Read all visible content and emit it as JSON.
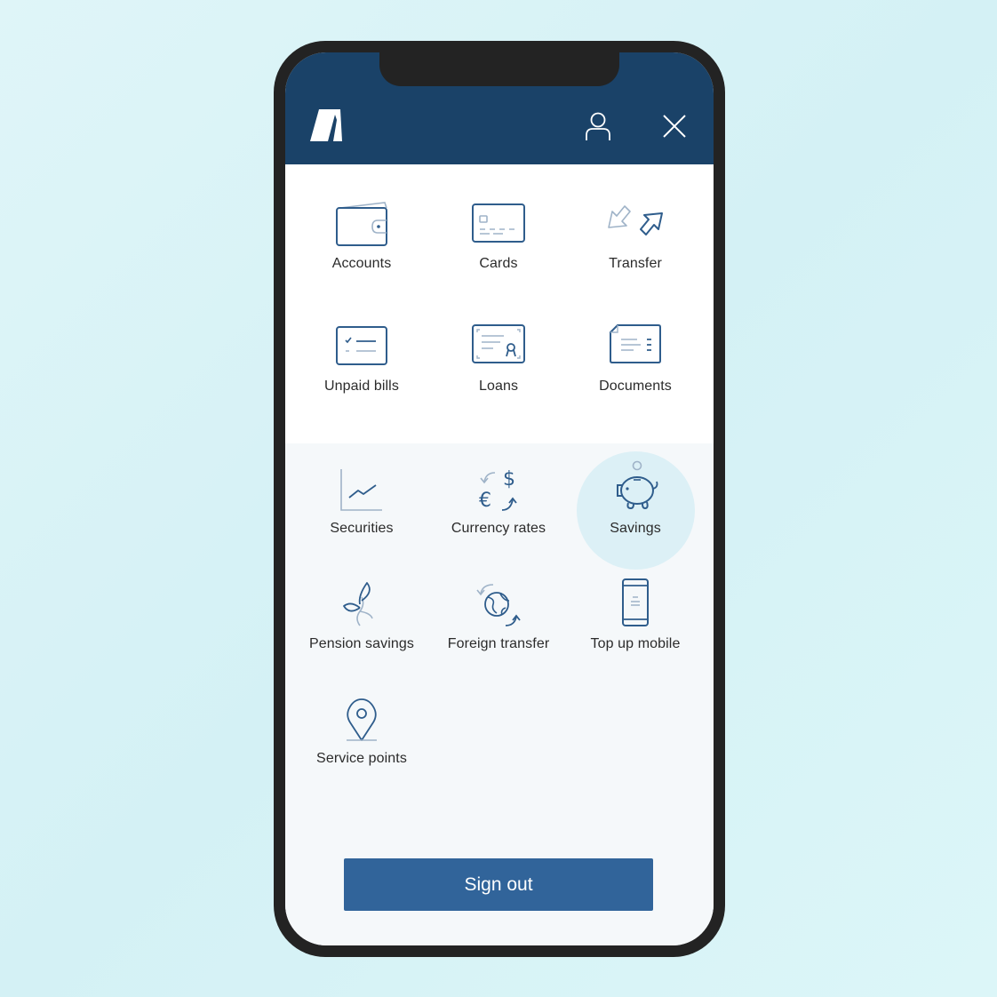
{
  "header": {
    "logo_icon": "bank-logo-icon",
    "profile_icon": "user-icon",
    "close_icon": "close-icon"
  },
  "menu": {
    "primary": [
      {
        "label": "Accounts",
        "icon": "wallet-icon"
      },
      {
        "label": "Cards",
        "icon": "credit-card-icon"
      },
      {
        "label": "Transfer",
        "icon": "transfer-arrows-icon"
      },
      {
        "label": "Unpaid bills",
        "icon": "bill-checklist-icon"
      },
      {
        "label": "Loans",
        "icon": "loan-certificate-icon"
      },
      {
        "label": "Documents",
        "icon": "document-icon"
      }
    ],
    "secondary": [
      {
        "label": "Securities",
        "icon": "line-chart-icon"
      },
      {
        "label": "Currency rates",
        "icon": "currency-exchange-icon"
      },
      {
        "label": "Savings",
        "icon": "piggy-bank-icon",
        "highlighted": true
      },
      {
        "label": "Pension savings",
        "icon": "plant-sprout-icon"
      },
      {
        "label": "Foreign transfer",
        "icon": "globe-exchange-icon"
      },
      {
        "label": "Top up mobile",
        "icon": "mobile-phone-icon"
      },
      {
        "label": "Service points",
        "icon": "map-pin-icon"
      }
    ]
  },
  "footer": {
    "sign_out_label": "Sign out"
  },
  "colors": {
    "header_bg": "#1a4268",
    "icon_primary": "#2f5d8c",
    "icon_secondary": "#9fb3c8",
    "button_bg": "#31649a",
    "highlight_bg": "#dcf0f6"
  }
}
